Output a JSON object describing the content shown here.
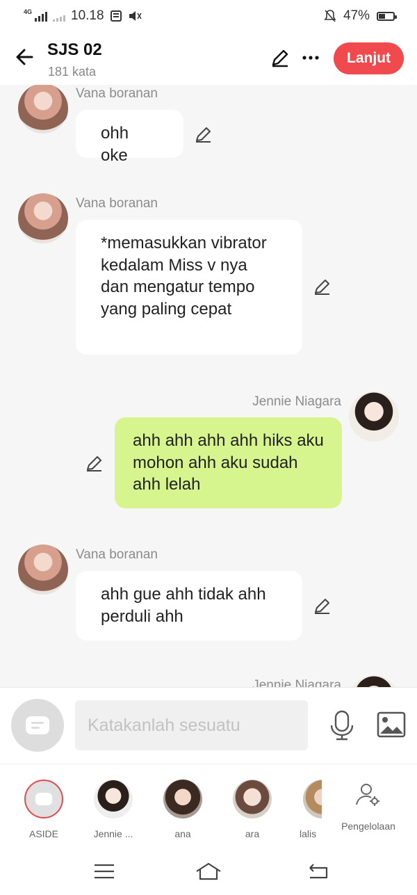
{
  "status_bar": {
    "network": "4G",
    "time": "10.18",
    "battery": "47%",
    "battery_level": 0.47
  },
  "header": {
    "title": "SJS 02",
    "word_count": "181 kata",
    "next_label": "Lanjut",
    "accent_color": "#f04a4f"
  },
  "messages": [
    {
      "sender": "Vana boranan",
      "text": "ohh oke",
      "side": "left"
    },
    {
      "sender": "Vana boranan",
      "text": "*memasukkan vibrator kedalam Miss v nya dan mengatur tempo yang paling cepat",
      "side": "left"
    },
    {
      "sender": "Jennie Niagara",
      "text": "ahh ahh ahh ahh hiks aku mohon ahh aku sudah ahh lelah",
      "side": "right"
    },
    {
      "sender": "Vana boranan",
      "text": "ahh gue ahh tidak ahh perduli ahh",
      "side": "left"
    },
    {
      "sender": "Jennie Niagara",
      "text": "",
      "side": "right"
    }
  ],
  "input": {
    "placeholder": "Katakanlah sesuatu"
  },
  "characters": [
    {
      "label": "ASIDE"
    },
    {
      "label": "Jennie ..."
    },
    {
      "label": "ana"
    },
    {
      "label": "ara"
    },
    {
      "label": "lalis"
    }
  ],
  "manage_label": "Pengelolaan",
  "icons": {
    "back": "arrow-left-icon",
    "edit": "pencil-icon",
    "more": "more-icon",
    "mic": "microphone-icon",
    "image": "image-icon",
    "manage": "user-gear-icon",
    "nav": [
      "menu-icon",
      "home-icon",
      "back-icon"
    ]
  },
  "colors": {
    "my_bubble": "#d6f58f",
    "other_bubble": "#ffffff"
  }
}
